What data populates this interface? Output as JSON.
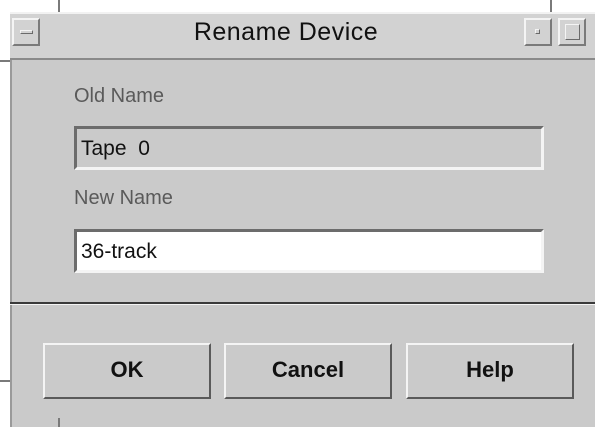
{
  "window": {
    "title": "Rename Device"
  },
  "form": {
    "old_name_label": "Old Name",
    "old_name_value": "Tape  0",
    "new_name_label": "New Name",
    "new_name_value": "36-track"
  },
  "buttons": {
    "ok_label": "OK",
    "cancel_label": "Cancel",
    "help_label": "Help"
  },
  "colors": {
    "window_bg": "#cacaca",
    "input_bg": "#ffffff"
  }
}
